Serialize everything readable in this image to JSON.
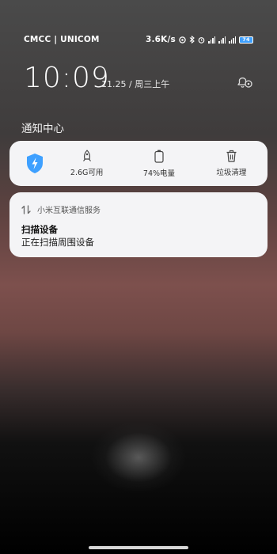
{
  "status_bar": {
    "carrier": "CMCC | UNICOM",
    "net_speed": "3.6K/s",
    "battery": "74"
  },
  "clock": {
    "time": "10:09",
    "date": "11.25 / 周三上午"
  },
  "notification_center": {
    "title": "通知中心"
  },
  "quick_panel": {
    "items": [
      {
        "icon": "rocket-icon",
        "label": "2.6G可用"
      },
      {
        "icon": "battery-icon",
        "label": "74%电量"
      },
      {
        "icon": "trash-icon",
        "label": "垃圾清理"
      }
    ]
  },
  "notification": {
    "app_name": "小米互联通信服务",
    "title": "扫描设备",
    "body": "正在扫描周围设备"
  },
  "colors": {
    "shield_accent": "#3ea0ff",
    "card_bg": "#f4f4f6"
  }
}
